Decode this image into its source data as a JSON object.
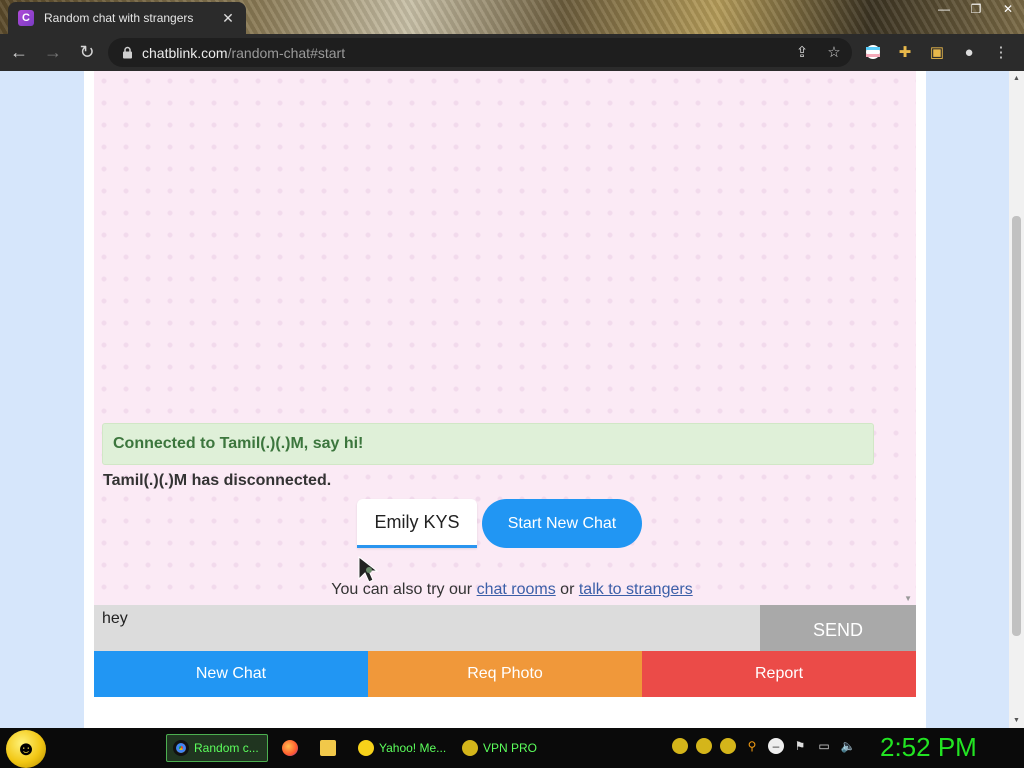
{
  "browser": {
    "tab_title": "Random chat with strangers",
    "tab_favicon_letter": "C",
    "url_host": "chatblink.com",
    "url_path": "/random-chat#start"
  },
  "chat": {
    "connected_message": "Connected to Tamil(.)(.)M, say hi!",
    "disconnected_message": "Tamil(.)(.)M has disconnected.",
    "name_value": "Emily KYS",
    "start_new_chat_label": "Start New Chat",
    "also_try_prefix": "You can also try our",
    "chat_rooms_link": "chat rooms",
    "also_try_or": "or",
    "talk_to_strangers_link": "talk to strangers",
    "message_value": "hey",
    "send_label": "SEND"
  },
  "actions": {
    "new_chat": "New Chat",
    "req_photo": "Req Photo",
    "report": "Report"
  },
  "colors": {
    "new_chat": "#2196f3",
    "req_photo": "#f0983a",
    "report": "#eb4b48",
    "connected_bg": "#dff0d8",
    "connected_text": "#3c763d"
  },
  "taskbar": {
    "items": [
      {
        "label": "Random c...",
        "icon": "chrome-icon"
      },
      {
        "label": "",
        "icon": "firefox-icon"
      },
      {
        "label": "",
        "icon": "folder-icon"
      },
      {
        "label": "Yahoo! Me...",
        "icon": "yahoo-messenger-icon"
      },
      {
        "label": "VPN PRO",
        "icon": "vpn-icon"
      }
    ],
    "clock": "2:52 PM"
  }
}
